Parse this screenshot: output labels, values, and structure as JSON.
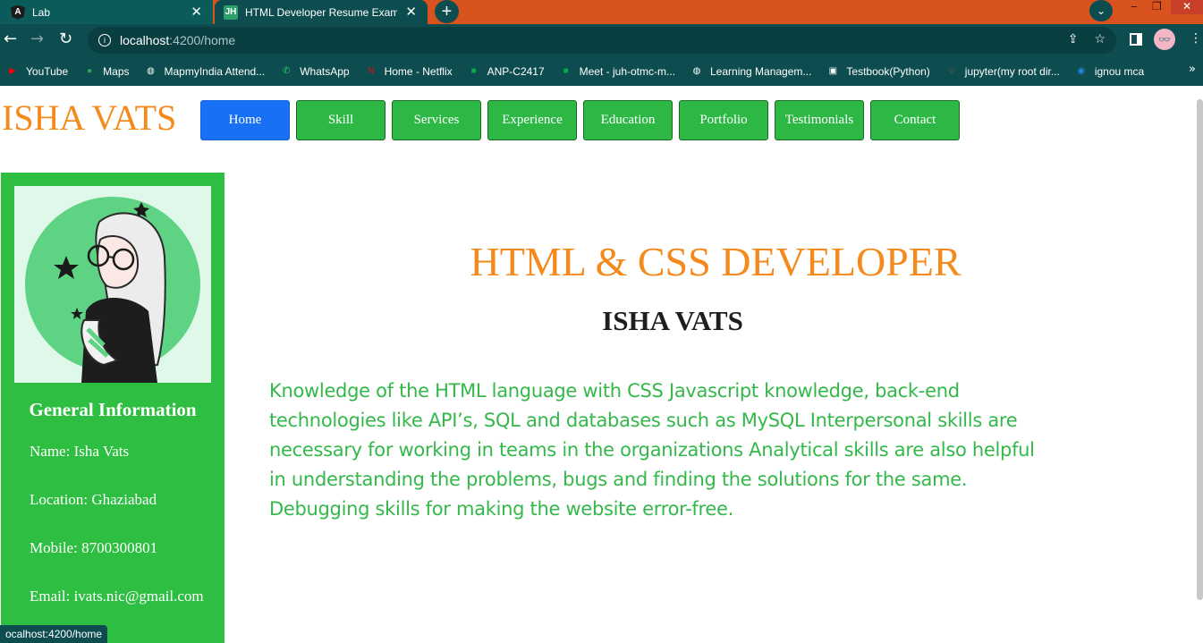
{
  "browser": {
    "tabs": [
      {
        "title": "Lab",
        "favicon": "angular-icon"
      },
      {
        "title": "HTML Developer Resume Exampl",
        "favicon": "jh-icon"
      }
    ],
    "favicon_text": {
      "angular": "A",
      "jh": "JH"
    },
    "url": {
      "host": "localhost",
      "path": ":4200/home"
    },
    "bookmarks": [
      {
        "label": "YouTube",
        "icon": "youtube-icon",
        "color": "#ff0000"
      },
      {
        "label": "Maps",
        "icon": "maps-pin-icon",
        "color": "#34a853"
      },
      {
        "label": "MapmyIndia Attend...",
        "icon": "globe-icon",
        "color": "#ffffff"
      },
      {
        "label": "WhatsApp",
        "icon": "whatsapp-icon",
        "color": "#25d366"
      },
      {
        "label": "Home - Netflix",
        "icon": "netflix-icon",
        "color": "#e50914"
      },
      {
        "label": "ANP-C2417",
        "icon": "meet-icon",
        "color": "#00ac47"
      },
      {
        "label": "Meet - juh-otmc-m...",
        "icon": "meet-icon",
        "color": "#00ac47"
      },
      {
        "label": "Learning Managem...",
        "icon": "globe-icon",
        "color": "#ffffff"
      },
      {
        "label": "Testbook(Python)",
        "icon": "testbook-icon",
        "color": "#ffffff"
      },
      {
        "label": "jupyter(my root dir...",
        "icon": "jupyter-icon",
        "color": "#f37726"
      },
      {
        "label": "ignou mca",
        "icon": "ignou-icon",
        "color": "#1e88e5"
      }
    ],
    "status_url": "ocalhost:4200/home"
  },
  "page": {
    "brand": "ISHA VATS",
    "nav": [
      {
        "label": "Home",
        "active": true
      },
      {
        "label": "Skill",
        "active": false
      },
      {
        "label": "Services",
        "active": false
      },
      {
        "label": "Experience",
        "active": false
      },
      {
        "label": "Education",
        "active": false
      },
      {
        "label": "Portfolio",
        "active": false
      },
      {
        "label": "Testimonials",
        "active": false
      },
      {
        "label": "Contact",
        "active": false
      }
    ],
    "sidebar": {
      "title": "General Information",
      "name": "Name: Isha Vats",
      "location": "Location: Ghaziabad",
      "mobile": "Mobile: 8700300801",
      "email": "Email: ivats.nic@gmail.com"
    },
    "hero": {
      "title": "HTML & CSS DEVELOPER",
      "name": "ISHA VATS",
      "description": "Knowledge of the HTML language with CSS Javascript knowledge, back-end technologies like API’s, SQL and databases such as MySQL Interpersonal skills are necessary for working in teams in the organizations Analytical skills are also helpful in understanding the problems, bugs and finding the solutions for the same. Debugging skills for making the website error-free."
    }
  },
  "colors": {
    "brand_orange": "#f4891c",
    "nav_green": "#2db845",
    "nav_active_blue": "#1871f5",
    "sidebar_green": "#2ebe42",
    "text_green": "#33b84a",
    "chrome_teal": "#0e4d4f",
    "tabstrip_orange": "#d9531e"
  }
}
